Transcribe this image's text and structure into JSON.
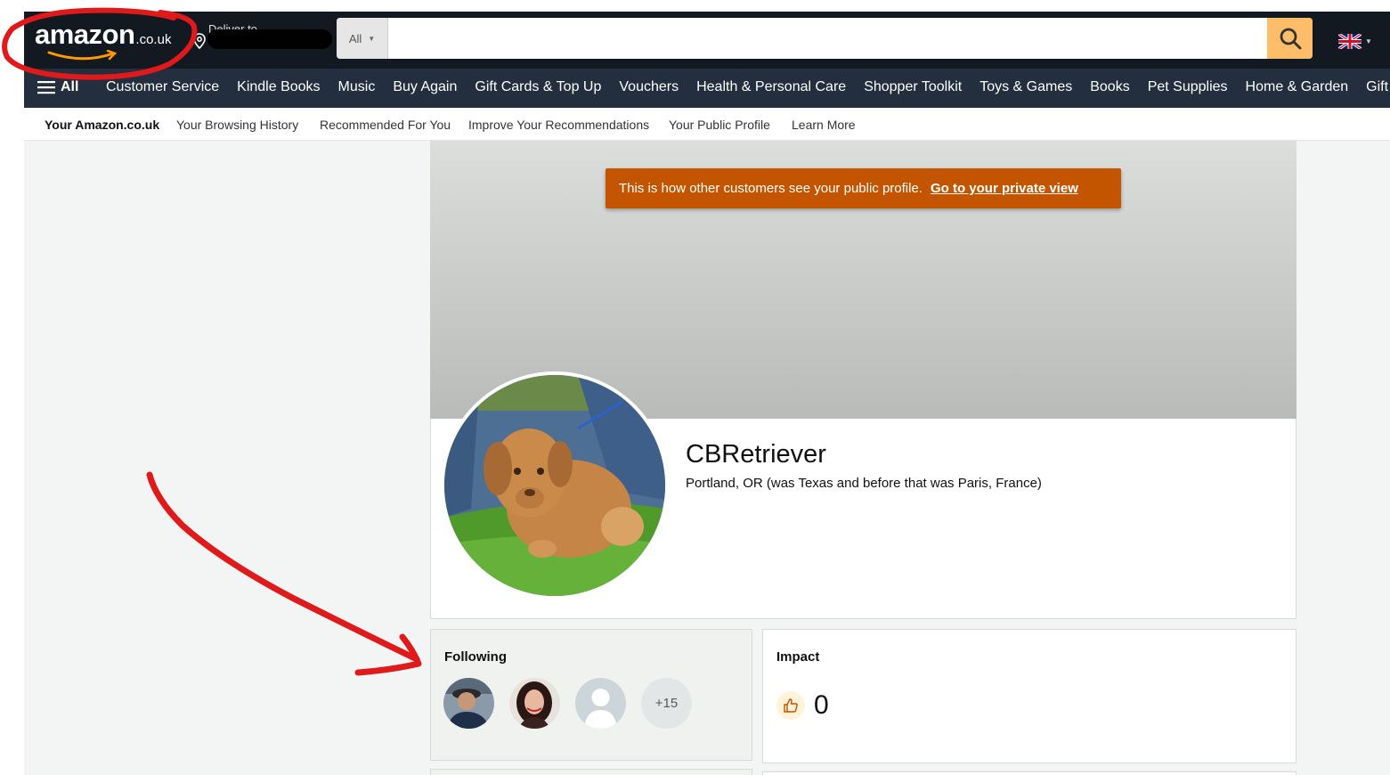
{
  "header": {
    "logo_text": "amazon",
    "logo_suffix": ".co.uk",
    "deliver_label": "Deliver to",
    "search": {
      "category": "All",
      "placeholder": "",
      "button_icon": "search-icon"
    },
    "language_flag": "uk-flag-icon"
  },
  "nav": {
    "all_label": "All",
    "items": [
      "Customer Service",
      "Kindle Books",
      "Music",
      "Buy Again",
      "Gift Cards & Top Up",
      "Vouchers",
      "Health & Personal Care",
      "Shopper Toolkit",
      "Toys & Games",
      "Books",
      "Pet Supplies",
      "Home & Garden",
      "Gift Ic"
    ]
  },
  "subnav": {
    "items": [
      "Your Amazon.co.uk",
      "Your Browsing History",
      "Recommended For You",
      "Improve Your Recommendations",
      "Your Public Profile",
      "Learn More"
    ]
  },
  "profile": {
    "notice_text": "This is how other customers see your public profile.",
    "notice_link": "Go to your private view",
    "name": "CBRetriever",
    "location": "Portland, OR (was Texas and before that was Paris, France)"
  },
  "following": {
    "title": "Following",
    "more_count": "+15"
  },
  "impact": {
    "title": "Impact",
    "value": "0"
  },
  "colors": {
    "header_bg": "#131921",
    "nav_bg": "#232f3e",
    "search_button": "#febd69",
    "notice_bg": "#c45500",
    "annotation": "#e0191b"
  }
}
